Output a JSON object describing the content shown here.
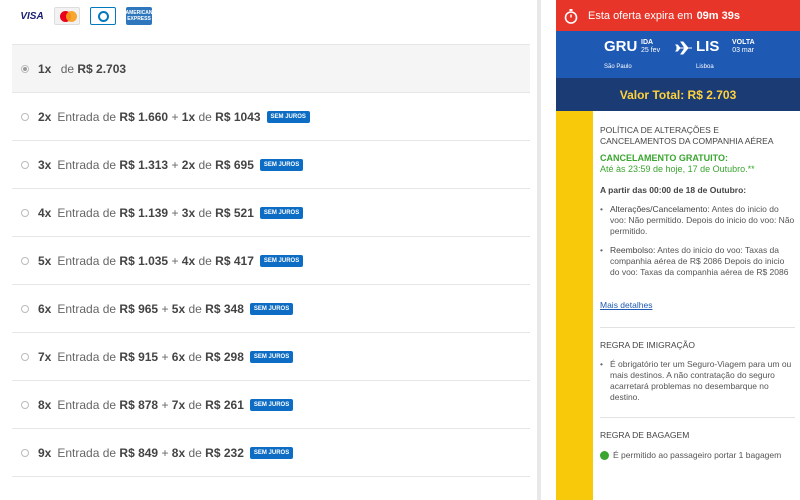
{
  "cards": [
    "VISA",
    "MasterCard",
    "Diners Club",
    "AMERICAN EXPRESS"
  ],
  "options": [
    {
      "times": "1x",
      "connector": " de ",
      "amount": "R$ 2.703",
      "selected": true
    },
    {
      "times": "2x",
      "text1": "Entrada de ",
      "entry": "R$ 1.660",
      "mid": " + ",
      "rest_times": "1x",
      "text2": " de ",
      "rest": "R$ 1043",
      "badge": "SEM JUROS"
    },
    {
      "times": "3x",
      "text1": "Entrada de ",
      "entry": "R$ 1.313",
      "mid": " + ",
      "rest_times": "2x",
      "text2": " de ",
      "rest": "R$ 695",
      "badge": "SEM JUROS"
    },
    {
      "times": "4x",
      "text1": "Entrada de ",
      "entry": "R$ 1.139",
      "mid": " + ",
      "rest_times": "3x",
      "text2": " de ",
      "rest": "R$ 521",
      "badge": "SEM JUROS"
    },
    {
      "times": "5x",
      "text1": "Entrada de ",
      "entry": "R$ 1.035",
      "mid": " + ",
      "rest_times": "4x",
      "text2": " de ",
      "rest": "R$ 417",
      "badge": "SEM JUROS"
    },
    {
      "times": "6x",
      "text1": "Entrada de ",
      "entry": "R$ 965",
      "mid": " + ",
      "rest_times": "5x",
      "text2": " de ",
      "rest": "R$ 348",
      "badge": "SEM JUROS"
    },
    {
      "times": "7x",
      "text1": "Entrada de ",
      "entry": "R$ 915",
      "mid": " + ",
      "rest_times": "6x",
      "text2": " de ",
      "rest": "R$ 298",
      "badge": "SEM JUROS"
    },
    {
      "times": "8x",
      "text1": "Entrada de ",
      "entry": "R$ 878",
      "mid": " + ",
      "rest_times": "7x",
      "text2": " de ",
      "rest": "R$ 261",
      "badge": "SEM JUROS"
    },
    {
      "times": "9x",
      "text1": "Entrada de ",
      "entry": "R$ 849",
      "mid": " + ",
      "rest_times": "8x",
      "text2": " de ",
      "rest": "R$ 232",
      "badge": "SEM JUROS"
    }
  ],
  "timer": {
    "text": "Esta oferta expira em",
    "value": "09m 39s"
  },
  "flight": {
    "origin": "GRU",
    "origin_leg": "IDA",
    "origin_date": "25 fev",
    "origin_city": "São Paulo",
    "dest": "LIS",
    "dest_leg": "VOLTA",
    "dest_date": "03 mar",
    "dest_city": "Lisboa"
  },
  "total": "Valor Total: R$ 2.703",
  "policy": {
    "title": "POLÍTICA DE ALTERAÇÕES E CANCELAMENTOS DA COMPANHIA AÉREA",
    "free_cancel": "CANCELAMENTO GRATUITO:",
    "free_until": "Até às 23:59 de hoje, 17 de Outubro.**",
    "from_label": "A partir das 00:00 de 18 de Outubro:",
    "changes_label": "Alterações/Cancelamento:",
    "changes_text": " Antes do inicio do voo: Não permitido. Depois do inicio do voo: Não permitido.",
    "refund_label": "Reembolso:",
    "refund_text": " Antes do inicio do voo: Taxas da companhia aérea de R$ 2086 Depois do inicio do voo: Taxas da companhia aérea de R$ 2086",
    "more": "Mais detalhes"
  },
  "immigration": {
    "title": "REGRA DE IMIGRAÇÃO",
    "text": "É obrigatório ter um Seguro-Viagem para um ou mais destinos. A não contratação do seguro acarretará problemas no desembarque no destino."
  },
  "baggage": {
    "title": "REGRA DE BAGAGEM",
    "text": "É permitido ao passageiro portar 1 bagagem"
  },
  "colors": {
    "timer": "#e8352a",
    "flight": "#1e59b4",
    "total_bg": "#1b3b74",
    "total_text": "#ffd23b",
    "stripe": "#f7c90a",
    "badge": "#0d6dc4",
    "green": "#3aa52f"
  }
}
